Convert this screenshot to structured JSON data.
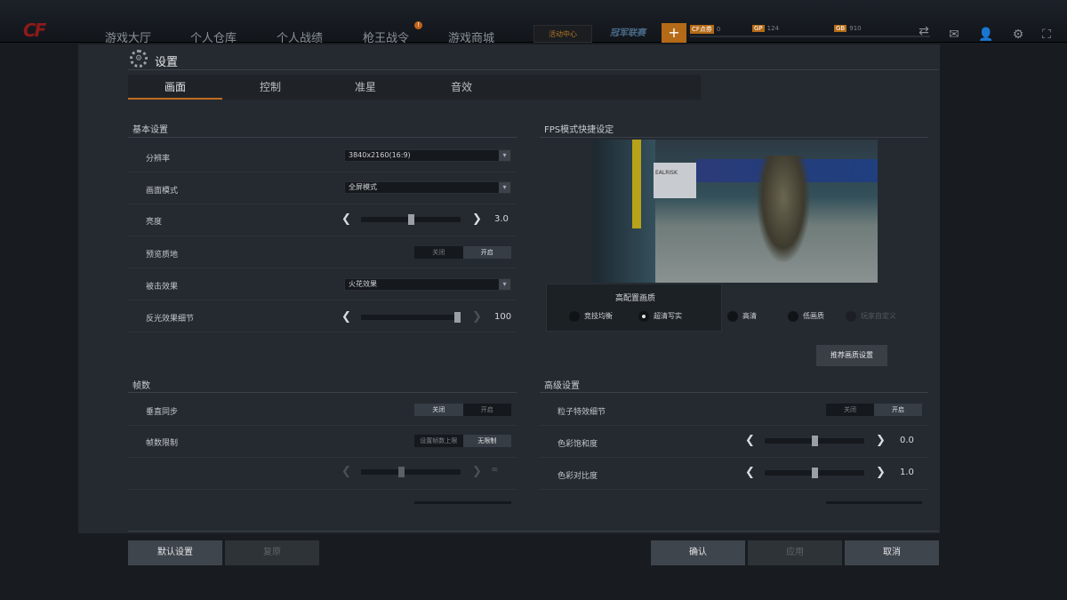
{
  "topbar": {
    "logo": "CF",
    "nav": [
      "游戏大厅",
      "个人仓库",
      "个人战绩",
      "枪王战令",
      "游戏商城"
    ],
    "nav_badge": "!",
    "event": "活动中心",
    "event2": "冠军联赛",
    "plus": "+",
    "currencies": [
      {
        "badge": "CF点券",
        "value": "0"
      },
      {
        "badge": "GP",
        "value": "124"
      },
      {
        "badge": "GB",
        "value": "910"
      }
    ]
  },
  "dialog": {
    "title": "设置",
    "tabs": [
      "画面",
      "控制",
      "准星",
      "音效"
    ],
    "active_tab": "画面",
    "basic": {
      "heading": "基本设置",
      "resolution": {
        "label": "分辨率",
        "value": "3840x2160(16:9)"
      },
      "display_mode": {
        "label": "画面模式",
        "value": "全屏模式"
      },
      "brightness": {
        "label": "亮度",
        "value": "3.0",
        "level": 0.5
      },
      "preview_quality": {
        "label": "预览质地",
        "off": "关闭",
        "on": "开启",
        "selected": "on"
      },
      "hit_effect": {
        "label": "被击效果",
        "value": "火花效果"
      },
      "reflection": {
        "label": "反光效果细节",
        "value": "100",
        "level": 1.0
      }
    },
    "fps": {
      "heading": "帧数",
      "vsync": {
        "label": "垂直同步",
        "off": "关闭",
        "on": "开启",
        "selected": "off"
      },
      "limit": {
        "label": "帧数限制",
        "opt1": "设置帧数上限",
        "opt2": "无限制",
        "selected": "opt2"
      },
      "limit_value": "∞"
    },
    "fps_mode": {
      "heading": "FPS模式快捷设定",
      "preview_sign": "EALRISK",
      "panel_title": "高配置画质",
      "options": [
        "竞技均衡",
        "超清写实",
        "高清",
        "低画质",
        "玩家自定义"
      ],
      "selected": "超清写实",
      "recommend_button": "推荐画质设置"
    },
    "advanced": {
      "heading": "高级设置",
      "particles": {
        "label": "粒子特效细节",
        "off": "关闭",
        "on": "开启",
        "selected": "on"
      },
      "saturation": {
        "label": "色彩饱和度",
        "value": "0.0",
        "level": 0.5
      },
      "contrast": {
        "label": "色彩对比度",
        "value": "1.0",
        "level": 0.5
      }
    },
    "footer": {
      "default": "默认设置",
      "restore": "复原",
      "confirm": "确认",
      "apply": "应用",
      "cancel": "取消"
    }
  },
  "colors": {
    "accent": "#c36a20",
    "panel": "#252a30",
    "button": "#3f454c"
  }
}
